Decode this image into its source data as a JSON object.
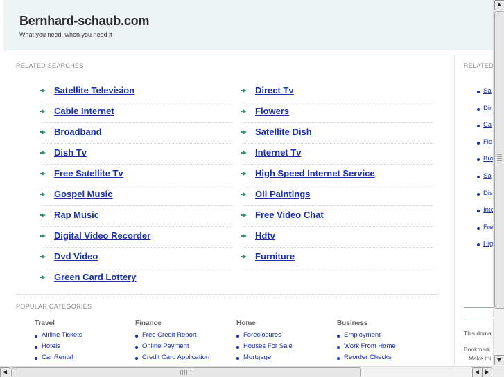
{
  "header": {
    "title": "Bernhard-schaub.com",
    "tagline": "What you need, when you need it"
  },
  "related": {
    "label": "RELATED SEARCHES",
    "left": [
      "Satellite Television",
      "Cable Internet",
      "Broadband",
      "Dish Tv",
      "Free Satellite Tv",
      "Gospel Music",
      "Rap Music",
      "Digital Video Recorder",
      "Dvd Video",
      "Green Card Lottery"
    ],
    "right": [
      "Direct Tv",
      "Flowers",
      "Satellite Dish",
      "Internet Tv",
      "High Speed Internet Service",
      "Oil Paintings",
      "Free Video Chat",
      "Hdtv",
      "Furniture"
    ]
  },
  "popular": {
    "label": "POPULAR CATEGORIES",
    "columns": [
      {
        "heading": "Travel",
        "items": [
          "Airline Tickets",
          "Hotels",
          "Car Rental"
        ]
      },
      {
        "heading": "Finance",
        "items": [
          "Free Credit Report",
          "Online Payment",
          "Credit Card Application"
        ]
      },
      {
        "heading": "Home",
        "items": [
          "Foreclosures",
          "Houses For Sale",
          "Mortgage"
        ]
      },
      {
        "heading": "Business",
        "items": [
          "Employment",
          "Work From Home",
          "Reorder Checks"
        ]
      }
    ]
  },
  "sidebar": {
    "label": "RELATED",
    "items": [
      "Sa",
      "Dir",
      "Ca",
      "Flo",
      "Bro",
      "Sa",
      "Dis",
      "Inte",
      "Fre",
      "Hig"
    ],
    "domain_text": "This doma",
    "bookmark_line1": "Bookmark",
    "bookmark_line2": "Make thi"
  },
  "colors": {
    "link": "#1a2fa8",
    "arrow": "#3a8a6e",
    "header_bg": "#eef3f6"
  },
  "icons": {
    "arrow": "arrow-right-icon",
    "bullet": "bullet-icon",
    "scroll_up": "chevron-up-icon",
    "scroll_down": "chevron-down-icon",
    "scroll_left": "chevron-left-icon",
    "scroll_right": "chevron-right-icon"
  }
}
